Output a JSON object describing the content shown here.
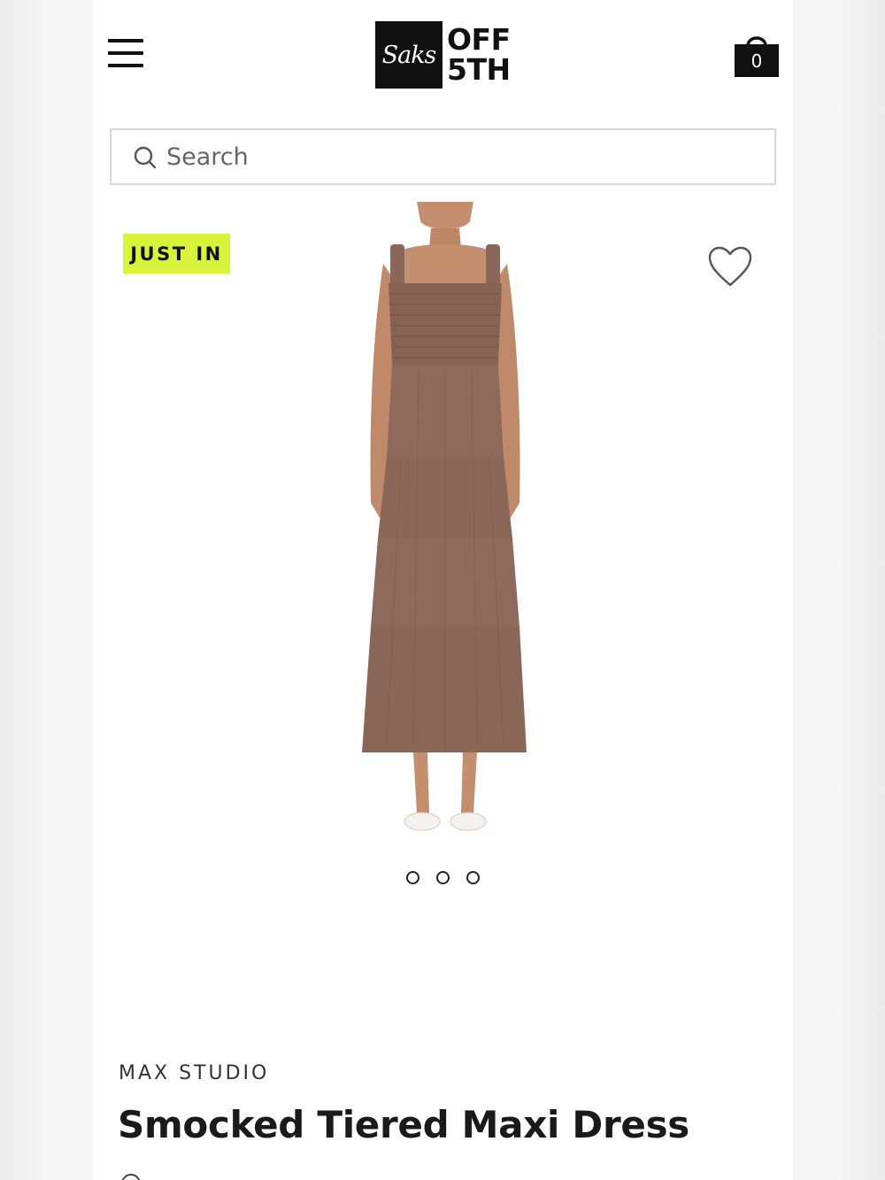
{
  "header": {
    "menu_icon": "hamburger-menu-icon",
    "logo": {
      "script": "Saks",
      "text": "OFF 5TH"
    },
    "bag": {
      "icon": "shopping-bag-icon",
      "count": "0"
    }
  },
  "search": {
    "placeholder": "Search",
    "icon": "search-icon"
  },
  "product": {
    "badge": "JUST IN",
    "badge_color": "#d7f33b",
    "wishlist_icon": "heart-icon",
    "image_count": 3,
    "active_image": 1,
    "brand": "MAX STUDIO",
    "name": "Smocked Tiered Maxi Dress"
  },
  "colors": {
    "dress": "#8e6a5c",
    "skin": "#c48f6f",
    "text": "#1a1a1a"
  }
}
